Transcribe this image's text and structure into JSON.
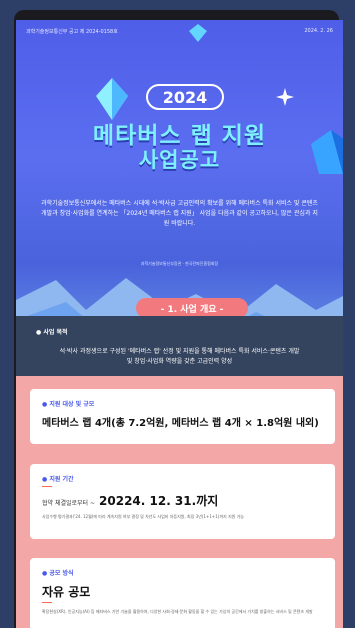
{
  "header": {
    "notice": "과학기술정보통신부 공고 제 2024-0158호",
    "date": "2024. 2. 26"
  },
  "hero": {
    "year": "2024",
    "title_line1": "메타버스 랩 지원",
    "title_line2": "사업공고",
    "intro": "과학기술정보통신부에서는 메타버스 시대에 석·박사급 고급인력의 확보를 위해 메타버스 특화 서비스 및 콘텐츠 개발과 창업·사업화를 연계하는 「2024년 메타버스 랩 지원」 사업을 다음과 같이 공고하오니, 많은 관심과 지원 바랍니다.",
    "orgs": "과학기술정보통신부장관 · 한국전파진흥협회장"
  },
  "section": {
    "title": "- 1. 사업 개요 -"
  },
  "purpose": {
    "title": "사업 목적",
    "text": "석·박사 과정생으로 구성된 '메타버스 랩' 선정 및 지원을 통해 메타버스 특화 서비스·콘텐츠 개발 및 창업·사업화 역량을 갖춘 고급인력 양성"
  },
  "cards": [
    {
      "title": "지원 대상 및 규모",
      "main": "메타버스 랩 4개(총 7.2억원, 메타버스 랩 4개 × 1.8억원 내외)"
    },
    {
      "title": "지원 기간",
      "prefix": "협약 체결일로부터 ~",
      "main": "20224. 12. 31.까지",
      "note": "사업수행 평가결과('24. 12월)에 따라 계속지원 여부 결정 및 차년도 사업비 차등지원, 최장 3년(1+1+1)까지 지원 가능"
    },
    {
      "title": "공모 방식",
      "main": "자유 공모",
      "note": "확장현실(XR), 인공지능(AI) 등 메타버스 기반 기술을 활용하여, 다양한 사회·경제·문화 활동을 할 수 있는 가상의 공간에서 가치를 창출하는 서비스 및 콘텐츠 개발"
    }
  ],
  "colors": {
    "bg": "#2d3f66",
    "hero": "#4f5ee8",
    "title": "#7ff0ff",
    "pill": "#f27a7e",
    "band": "#34445e",
    "salmon": "#f3a7a7",
    "accent": "#4858ea"
  }
}
